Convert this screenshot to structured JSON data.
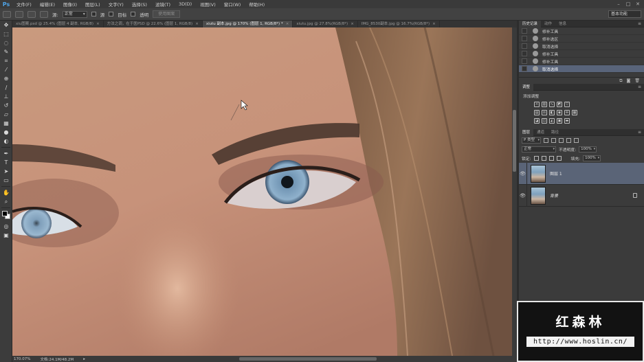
{
  "app": {
    "logo": "Ps"
  },
  "menu": {
    "items": [
      "文件(F)",
      "编辑(E)",
      "图像(I)",
      "图层(L)",
      "文字(Y)",
      "选择(S)",
      "滤镜(T)",
      "3D(D)",
      "视图(V)",
      "窗口(W)",
      "帮助(H)"
    ]
  },
  "options_bar": {
    "sample_label": "源:",
    "mode_label": "模式:",
    "mode_value": "正常",
    "source_label": "源",
    "aligned_label": "目标",
    "transparent_label": "透明",
    "use_pattern_label": "使用图案",
    "workspace": "基本功能"
  },
  "doc_tabs": [
    {
      "label": "xiu图案.psd @ 25.4% (图层 4 副本, RGB/8)",
      "active": false
    },
    {
      "label": "方法之调，在于医PSD @ 22.6% (图层 1, RGB/8)",
      "active": false
    },
    {
      "label": "xiutu 副本.jpg @ 170% (图层 1, RGB/8*) *",
      "active": true
    },
    {
      "label": "xiutu.jpg @ 27.8%(RGB/8*)",
      "active": false
    },
    {
      "label": "IMG_8530副本.jpg @ 16.7%(RGB/8*)",
      "active": false
    }
  ],
  "status": {
    "zoom": "170.07%",
    "doc_info": "文档:24.1M/48.2M"
  },
  "history_panel": {
    "tabs": [
      "历史记录",
      "动作",
      "信息"
    ],
    "items": [
      {
        "label": "修补工具",
        "selected": false
      },
      {
        "label": "修补选区",
        "selected": false
      },
      {
        "label": "取消选择",
        "selected": false
      },
      {
        "label": "修补工具",
        "selected": false
      },
      {
        "label": "修补工具",
        "selected": false
      },
      {
        "label": "取消选择",
        "selected": true
      }
    ]
  },
  "adjustments_panel": {
    "tabs": [
      "调整"
    ],
    "title": "添加调整"
  },
  "layers_panel": {
    "tabs": [
      "图层",
      "通道",
      "路径"
    ],
    "filter_value": "P 类型",
    "blend_mode": "正常",
    "opacity_label": "不透明度:",
    "opacity_value": "100%",
    "lock_label": "锁定:",
    "fill_label": "填充:",
    "fill_value": "100%",
    "layers": [
      {
        "name": "图层 1",
        "selected": true,
        "locked": false
      },
      {
        "name": "背景",
        "selected": false,
        "locked": true
      }
    ]
  },
  "watermark": {
    "title": "红森林",
    "url": "http://www.hoslin.cn/"
  },
  "icons": {
    "tools": [
      "move-icon",
      "marquee-icon",
      "lasso-icon",
      "quick-select-icon",
      "crop-icon",
      "eyedropper-icon",
      "healing-brush-icon",
      "brush-icon",
      "clone-stamp-icon",
      "history-brush-icon",
      "eraser-icon",
      "gradient-icon",
      "blur-icon",
      "dodge-icon",
      "pen-icon",
      "type-icon",
      "path-select-icon",
      "shape-icon",
      "hand-icon",
      "zoom-icon"
    ]
  }
}
